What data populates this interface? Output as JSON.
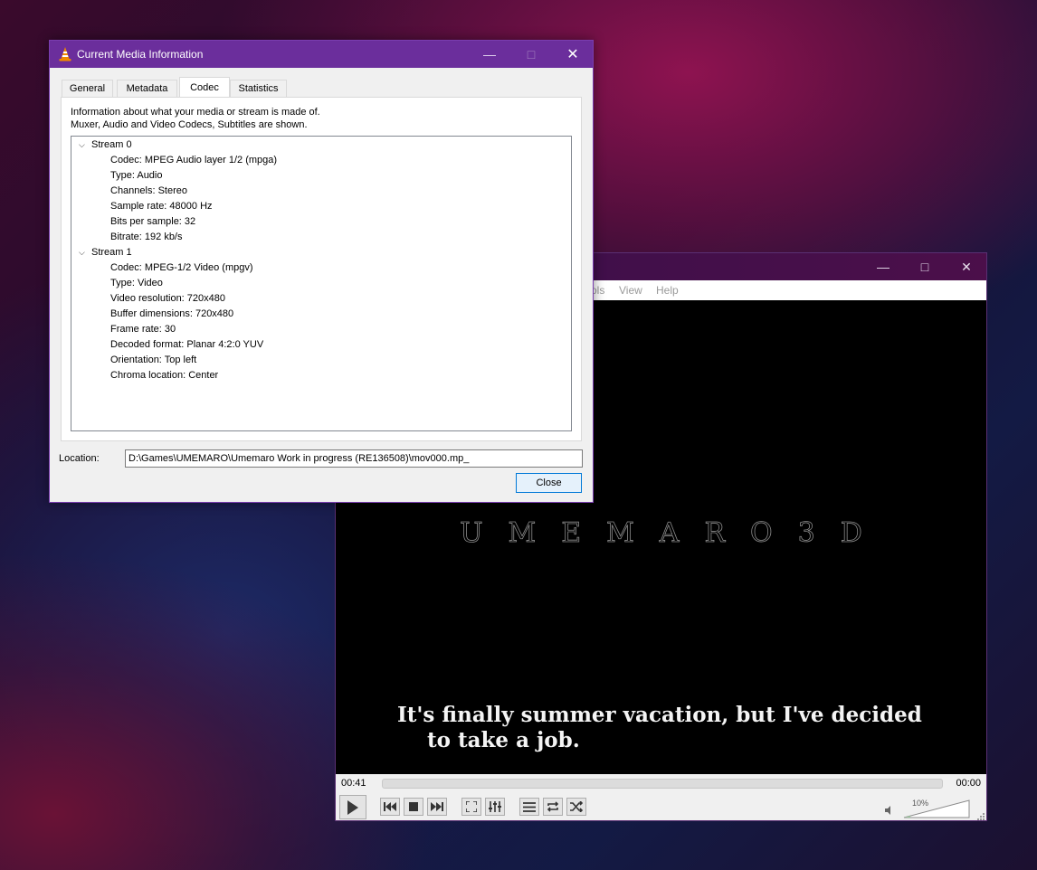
{
  "player": {
    "menu": [
      "ols",
      "View",
      "Help"
    ],
    "logo": "UMEMARO3D",
    "subtitle": {
      "line1": "It's finally summer vacation, but I've decided",
      "line2": "to take a job."
    },
    "time_elapsed": "00:41",
    "time_total": "00:00",
    "volume": {
      "label": "10%",
      "level": 0.1
    },
    "controls": [
      "play-icon",
      "previous-icon",
      "stop-icon",
      "next-icon",
      "fullscreen-icon",
      "extended-settings-icon",
      "playlist-icon",
      "loop-icon",
      "shuffle-icon"
    ]
  },
  "dialog": {
    "title": "Current Media Information",
    "tabs": [
      "General",
      "Metadata",
      "Codec",
      "Statistics"
    ],
    "active_tab": "Codec",
    "description": [
      "Information about what your media or stream is made of.",
      "Muxer, Audio and Video Codecs, Subtitles are shown."
    ],
    "streams": [
      {
        "name": "Stream 0",
        "properties": [
          "Codec: MPEG Audio layer 1/2 (mpga)",
          "Type: Audio",
          "Channels: Stereo",
          "Sample rate: 48000 Hz",
          "Bits per sample: 32",
          "Bitrate: 192 kb/s"
        ]
      },
      {
        "name": "Stream 1",
        "properties": [
          "Codec: MPEG-1/2 Video (mpgv)",
          "Type: Video",
          "Video resolution: 720x480",
          "Buffer dimensions: 720x480",
          "Frame rate: 30",
          "Decoded format: Planar 4:2:0 YUV",
          "Orientation: Top left",
          "Chroma location: Center"
        ]
      }
    ],
    "location_label": "Location:",
    "location_value": "D:\\Games\\UMEMARO\\Umemaro Work in progress (RE136508)\\mov000.mp_",
    "close_label": "Close"
  },
  "colors": {
    "dialog_titlebar": "#6b2e9c",
    "vlc_orange": "#f08a00",
    "accent_blue": "#0078d7"
  }
}
